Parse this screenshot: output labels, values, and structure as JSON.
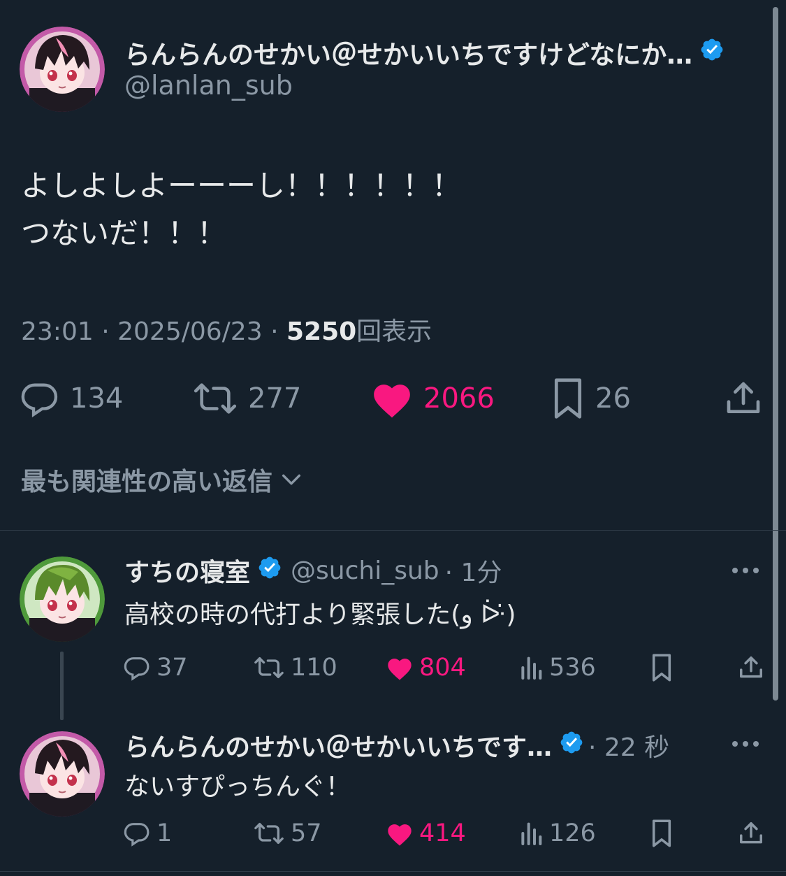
{
  "main_tweet": {
    "display_name": "らんらんのせかい＠せかいいちですけどなにか…",
    "handle": "@lanlan_sub",
    "text_lines": [
      "よしよしよーーーし！！！！！！",
      "つないだ！！！"
    ],
    "time": "23:01",
    "date": "2025/06/23",
    "views": "5250",
    "views_label": "回表示",
    "separator": "·",
    "actions": {
      "replies": "134",
      "retweets": "277",
      "likes": "2066",
      "bookmarks": "26"
    }
  },
  "reply_sort": {
    "label": "最も関連性の高い返信"
  },
  "replies": [
    {
      "display_name": "すちの寝室",
      "handle": "@suchi_sub",
      "time": "· 1分",
      "text": "高校の時の代打より緊張した(و ᐕ̇)",
      "actions": {
        "replies": "37",
        "retweets": "110",
        "likes": "804",
        "views": "536"
      }
    },
    {
      "display_name": "らんらんのせかい＠せかいいちです…",
      "handle": "",
      "time": "· 22 秒",
      "text": "ないすぴっちんぐ！",
      "actions": {
        "replies": "1",
        "retweets": "57",
        "likes": "414",
        "views": "126"
      }
    }
  ],
  "colors": {
    "background": "#15202b",
    "text": "#e7e9ea",
    "muted": "#8b98a5",
    "like": "#f91880",
    "verified": "#1d9bf0"
  }
}
